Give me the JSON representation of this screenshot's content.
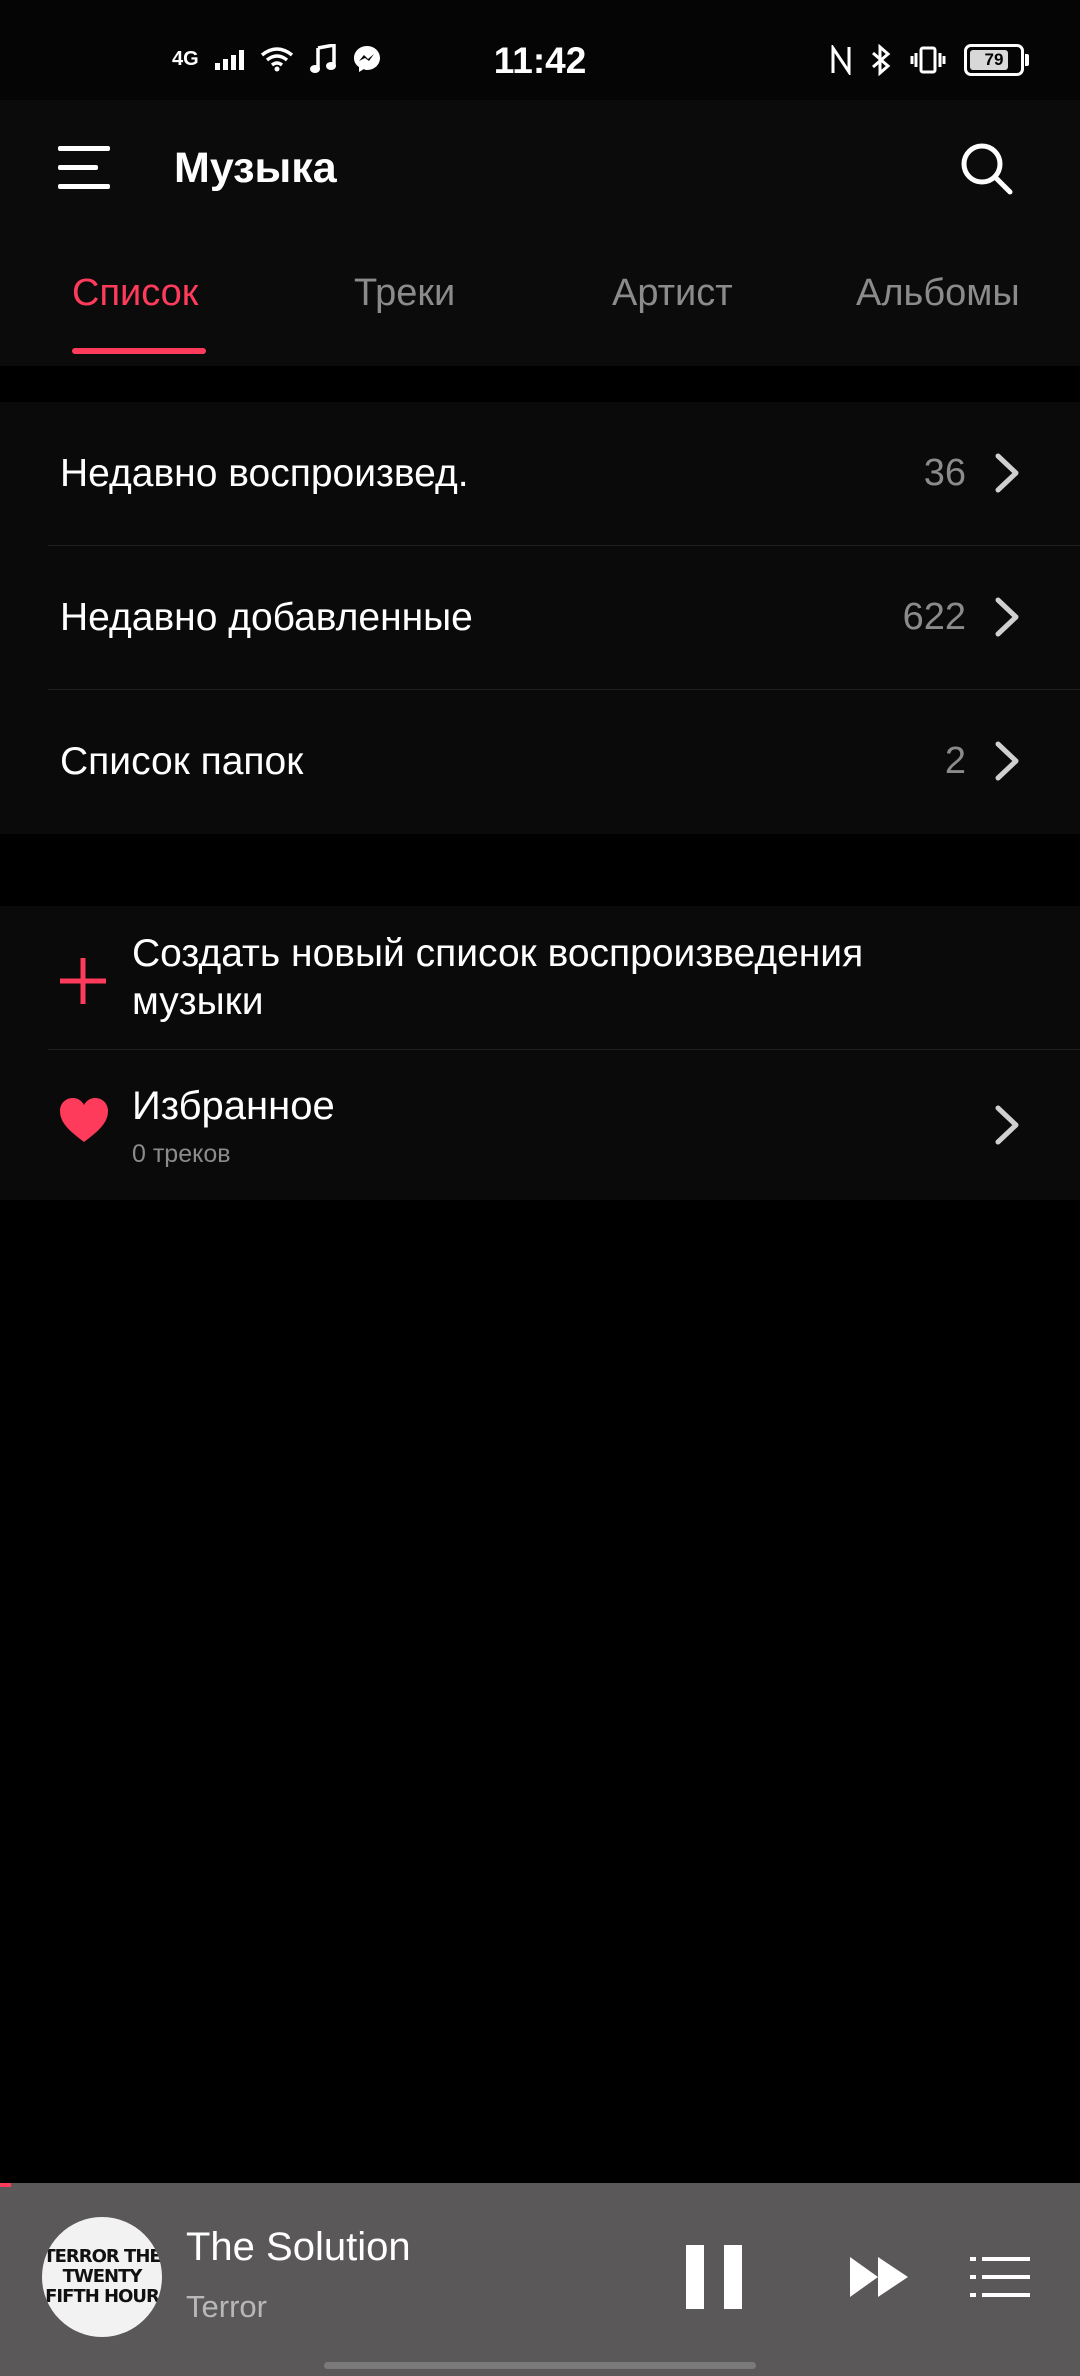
{
  "status_bar": {
    "network": "4G",
    "time": "11:42",
    "battery": "79",
    "battery_level": 0.79,
    "icons": [
      "signal-icon",
      "wifi-icon",
      "music-note-icon",
      "messenger-icon",
      "nfc-icon",
      "bluetooth-icon",
      "vibrate-icon",
      "battery-icon"
    ]
  },
  "app_bar": {
    "title": "Музыка",
    "menu_icon": "hamburger-icon",
    "search_icon": "search-icon"
  },
  "tabs": [
    {
      "label": "Список",
      "active": true
    },
    {
      "label": "Треки",
      "active": false
    },
    {
      "label": "Артист",
      "active": false
    },
    {
      "label": "Альбомы",
      "active": false
    }
  ],
  "lists": [
    {
      "label": "Недавно воспроизвед.",
      "count": "36"
    },
    {
      "label": "Недавно добавленные",
      "count": "622"
    },
    {
      "label": "Список папок",
      "count": "2"
    }
  ],
  "playlists": {
    "create_label": "Создать новый список воспроизведения музыки",
    "favorites": {
      "title": "Избранное",
      "subtitle": "0 треков"
    }
  },
  "now_playing": {
    "title": "The Solution",
    "artist": "Terror",
    "cover_text": "TERROR THE TWENTY FIFTH HOUR",
    "progress": 0.01
  },
  "colors": {
    "accent": "#ff3b5c",
    "background": "#000000",
    "player_bg": "#5a5858"
  }
}
